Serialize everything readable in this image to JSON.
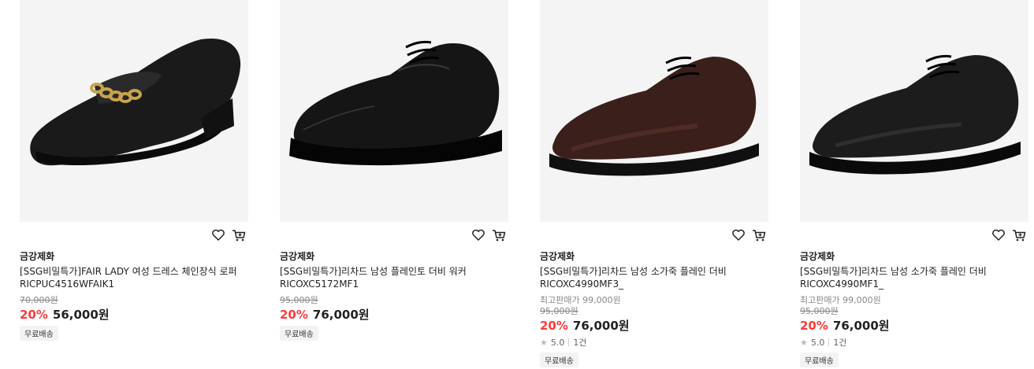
{
  "products": [
    {
      "brand": "금강제화",
      "title": "[SSG비밀특가]FAIR LADY 여성 드레스 체인장식 로퍼 RICPUC4516WFAIK1",
      "original_price": "70,000원",
      "discount": "20%",
      "price": "56,000원",
      "shipping": "무료배송",
      "image_icon": "black-chain-loafer",
      "wish_icon": "heart-icon",
      "cart_icon": "cart-icon"
    },
    {
      "brand": "금강제화",
      "title": "[SSG비밀특가]리차드 남성 플레인토 더비 워커 RICOXC5172MF1",
      "original_price": "95,000원",
      "discount": "20%",
      "price": "76,000원",
      "shipping": "무료배송",
      "image_icon": "black-derby-walker",
      "wish_icon": "heart-icon",
      "cart_icon": "cart-icon"
    },
    {
      "brand": "금강제화",
      "title": "[SSG비밀특가]리차드 남성 소가죽 플레인 더비 RICOXC4990MF3_",
      "highest_price_label": "최고판매가 99,000원",
      "original_price": "95,000원",
      "discount": "20%",
      "price": "76,000원",
      "rating": "5.0",
      "review_count": "1건",
      "shipping": "무료배송",
      "image_icon": "brown-plain-derby",
      "wish_icon": "heart-icon",
      "cart_icon": "cart-icon"
    },
    {
      "brand": "금강제화",
      "title": "[SSG비밀특가]리차드 남성 소가죽 플레인 더비 RICOXC4990MF1_",
      "highest_price_label": "최고판매가 99,000원",
      "original_price": "95,000원",
      "discount": "20%",
      "price": "76,000원",
      "rating": "5.0",
      "review_count": "1건",
      "shipping": "무료배송",
      "image_icon": "black-plain-derby",
      "wish_icon": "heart-icon",
      "cart_icon": "cart-icon"
    }
  ],
  "colors": {
    "discount": "#ff3a3a",
    "image_bg": "#f4f4f4",
    "badge_bg": "#f3f3f3"
  }
}
